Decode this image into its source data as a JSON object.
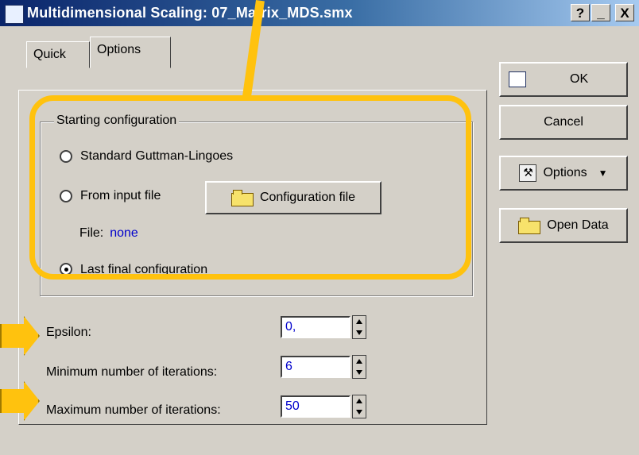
{
  "window": {
    "title": "Multidimensional Scaling: 07_Matrix_MDS.smx",
    "help_button": "?",
    "minimize_button": "_",
    "close_button": "X"
  },
  "tabs": [
    {
      "label": "Quick",
      "active": false
    },
    {
      "label": "Options",
      "active": true
    }
  ],
  "starting_configuration": {
    "legend": "Starting configuration",
    "options": [
      {
        "label": "Standard Guttman-Lingoes",
        "selected": false
      },
      {
        "label": "From input file",
        "selected": false
      },
      {
        "label": "Last final configuration",
        "selected": true
      }
    ],
    "config_file_button": "Configuration file",
    "file_label": "File:",
    "file_value": "none"
  },
  "fields": {
    "epsilon_label": "Epsilon:",
    "epsilon_value": "0,",
    "min_iterations_label": "Minimum number of iterations:",
    "min_iterations_value": "6",
    "max_iterations_label": "Maximum number of iterations:",
    "max_iterations_value": "50"
  },
  "side_buttons": {
    "ok": "OK",
    "cancel": "Cancel",
    "options": "Options",
    "open_data": "Open Data"
  },
  "annotation_color": "#ffc20e"
}
